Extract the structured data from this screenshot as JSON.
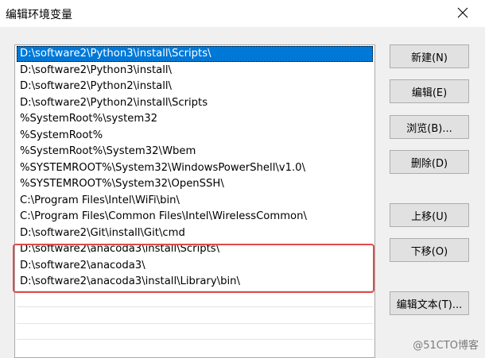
{
  "window": {
    "title": "编辑环境变量",
    "close_label": "×"
  },
  "path_list": [
    {
      "value": "D:\\software2\\Python3\\install\\Scripts\\",
      "selected": true
    },
    {
      "value": "D:\\software2\\Python3\\install\\",
      "selected": false
    },
    {
      "value": "D:\\software2\\Python2\\install\\",
      "selected": false
    },
    {
      "value": "D:\\software2\\Python2\\install\\Scripts",
      "selected": false
    },
    {
      "value": "%SystemRoot%\\system32",
      "selected": false
    },
    {
      "value": "%SystemRoot%",
      "selected": false
    },
    {
      "value": "%SystemRoot%\\System32\\Wbem",
      "selected": false
    },
    {
      "value": "%SYSTEMROOT%\\System32\\WindowsPowerShell\\v1.0\\",
      "selected": false
    },
    {
      "value": "%SYSTEMROOT%\\System32\\OpenSSH\\",
      "selected": false
    },
    {
      "value": "C:\\Program Files\\Intel\\WiFi\\bin\\",
      "selected": false
    },
    {
      "value": "C:\\Program Files\\Common Files\\Intel\\WirelessCommon\\",
      "selected": false
    },
    {
      "value": "D:\\software2\\Git\\install\\Git\\cmd",
      "selected": false
    },
    {
      "value": "D:\\software2\\anacoda3\\install\\Scripts\\",
      "selected": false
    },
    {
      "value": "D:\\software2\\anacoda3\\",
      "selected": false
    },
    {
      "value": "D:\\software2\\anacoda3\\install\\Library\\bin\\",
      "selected": false
    }
  ],
  "buttons": {
    "new": "新建(N)",
    "edit": "编辑(E)",
    "browse": "浏览(B)...",
    "delete": "删除(D)",
    "move_up": "上移(U)",
    "move_down": "下移(O)",
    "edit_text": "编辑文本(T)..."
  },
  "watermark": "@51CTO博客",
  "colors": {
    "selection": "#0078d7",
    "highlight_border": "#e04b4b",
    "dialog_background": "#f0f0f0"
  }
}
